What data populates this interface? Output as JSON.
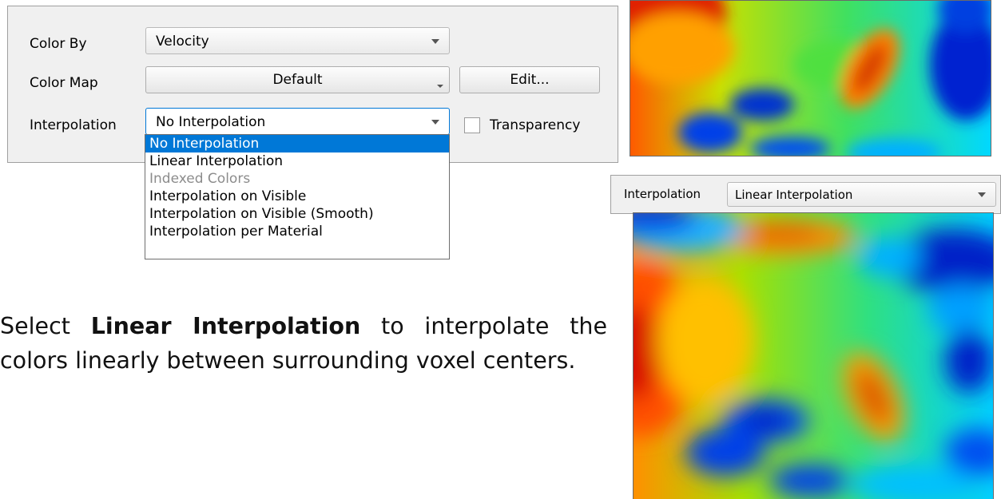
{
  "panel": {
    "color_by": {
      "label": "Color By",
      "value": "Velocity"
    },
    "color_map": {
      "label": "Color Map",
      "value": "Default",
      "edit_button": "Edit..."
    },
    "interpolation": {
      "label": "Interpolation",
      "value": "No Interpolation"
    },
    "transparency": {
      "label": "Transparency",
      "checked": false
    }
  },
  "dropdown": {
    "options": [
      {
        "label": "No Interpolation",
        "state": "selected"
      },
      {
        "label": "Linear Interpolation",
        "state": "normal"
      },
      {
        "label": "Indexed Colors",
        "state": "disabled"
      },
      {
        "label": "Interpolation on Visible",
        "state": "normal"
      },
      {
        "label": "Interpolation on Visible (Smooth)",
        "state": "normal"
      },
      {
        "label": "Interpolation per Material",
        "state": "normal"
      }
    ]
  },
  "caption": {
    "before": "Select ",
    "bold": "Linear Interpolation",
    "after": " to interpolate the colors linearly between surrounding voxel centers."
  },
  "linear_combo": {
    "label": "Interpolation",
    "value": "Linear Interpolation"
  },
  "colors": {
    "selection": "#0078d7",
    "disabled_text": "#8c8c8c",
    "panel_bg": "#f0f0f0",
    "colormap": [
      "#0000c8",
      "#0060ff",
      "#00c8ff",
      "#00e0a0",
      "#40e040",
      "#c8e000",
      "#ffc000",
      "#ff6000",
      "#d01000"
    ]
  }
}
